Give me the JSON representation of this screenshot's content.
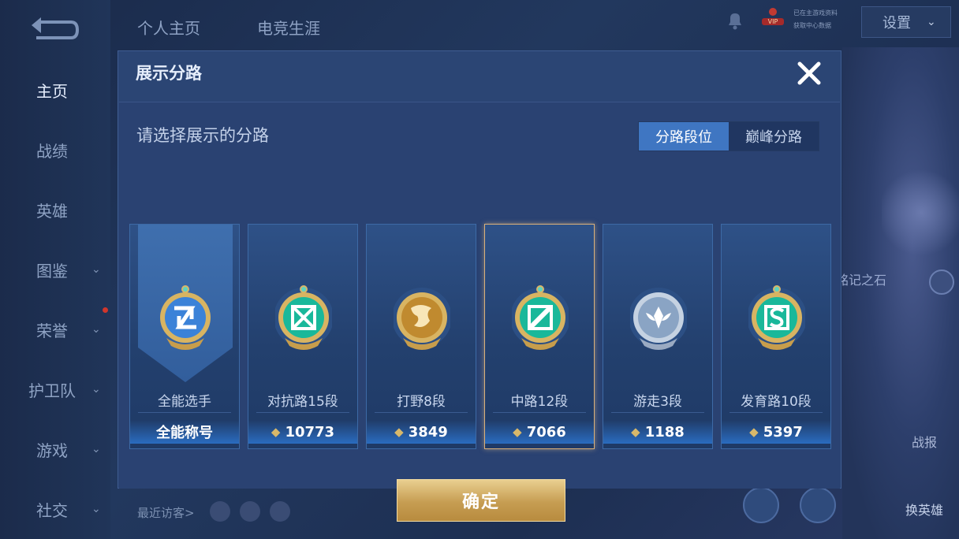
{
  "sidebar": {
    "items": [
      {
        "label": "主页",
        "chevron": false
      },
      {
        "label": "战绩",
        "chevron": false
      },
      {
        "label": "英雄",
        "chevron": false
      },
      {
        "label": "图鉴",
        "chevron": true
      },
      {
        "label": "荣誉",
        "chevron": true
      },
      {
        "label": "护卫队",
        "chevron": true
      },
      {
        "label": "游戏",
        "chevron": true
      },
      {
        "label": "社交",
        "chevron": true
      }
    ]
  },
  "topnav": {
    "tab1": "个人主页",
    "tab2": "电竞生涯"
  },
  "topright": {
    "vip": "VIP",
    "line1": "已在主游戏资料",
    "line2": "获取中心数据",
    "settings": "设置"
  },
  "bottom": {
    "recent_visitors": "最近访客>",
    "right_label1": "战报",
    "right_label2": "换英雄",
    "right_label3": "铭记之石"
  },
  "dialog": {
    "title": "展示分路",
    "prompt": "请选择展示的分路",
    "tabs": [
      {
        "label": "分路段位",
        "active": true
      },
      {
        "label": "巅峰分路",
        "active": false
      }
    ],
    "confirm": "确定",
    "cards": [
      {
        "lane": "全能选手",
        "score": "全能称号",
        "badge_color": "#3b82d8",
        "selected": false,
        "ribbon": true
      },
      {
        "lane": "对抗路15段",
        "score": "10773",
        "badge_color": "#19b89a",
        "selected": false,
        "ribbon": false
      },
      {
        "lane": "打野8段",
        "score": "3849",
        "badge_color": "#c08a2f",
        "selected": false,
        "ribbon": false
      },
      {
        "lane": "中路12段",
        "score": "7066",
        "badge_color": "#19b89a",
        "selected": true,
        "ribbon": false
      },
      {
        "lane": "游走3段",
        "score": "1188",
        "badge_color": "#8aa4c4",
        "selected": false,
        "ribbon": false
      },
      {
        "lane": "发育路10段",
        "score": "5397",
        "badge_color": "#19b89a",
        "selected": false,
        "ribbon": false
      }
    ]
  },
  "colors": {
    "accent": "#3f76c2",
    "gold": "#d9b07a",
    "dialog_bg": "#2a4473"
  }
}
